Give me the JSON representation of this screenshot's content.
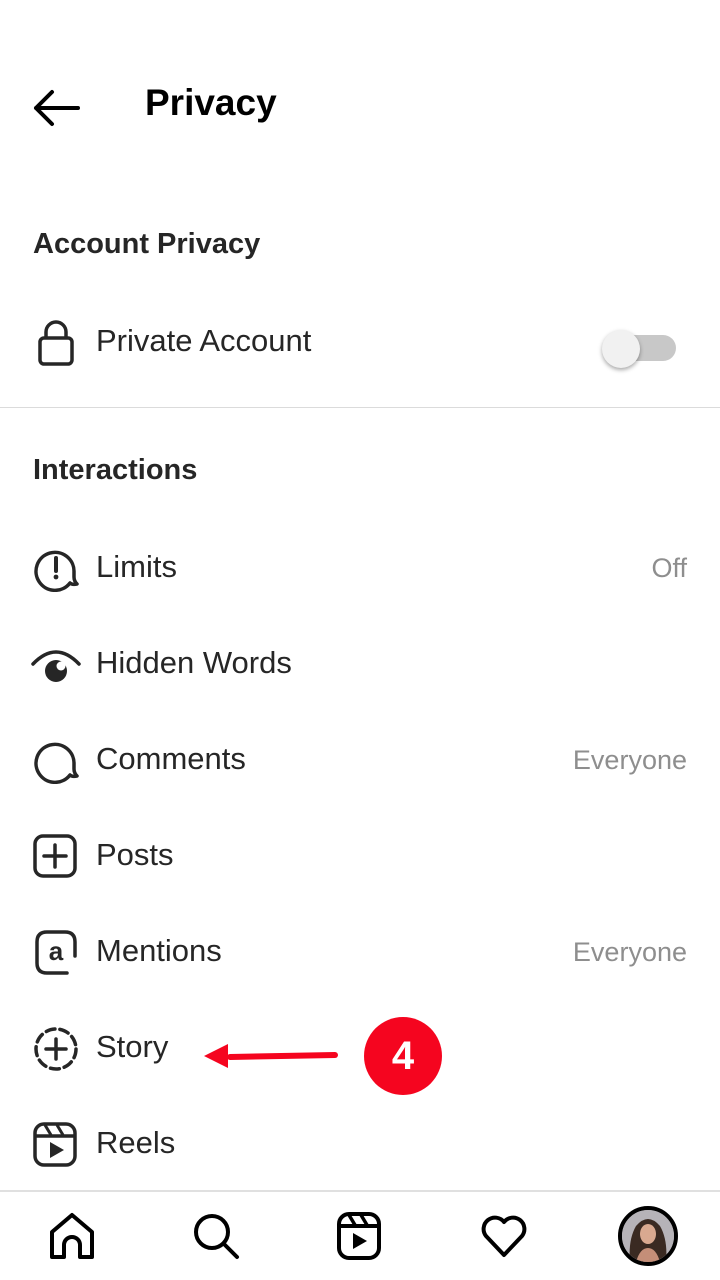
{
  "header": {
    "title": "Privacy",
    "back_icon": "arrow-left-icon"
  },
  "sections": {
    "account_privacy": {
      "title": "Account Privacy",
      "private_account": {
        "label": "Private Account",
        "icon": "lock-icon",
        "toggle_on": false
      }
    },
    "interactions": {
      "title": "Interactions",
      "items": [
        {
          "label": "Limits",
          "value": "Off",
          "icon": "alert-bubble-icon"
        },
        {
          "label": "Hidden Words",
          "value": "",
          "icon": "eye-icon"
        },
        {
          "label": "Comments",
          "value": "Everyone",
          "icon": "comment-icon"
        },
        {
          "label": "Posts",
          "value": "",
          "icon": "plus-square-icon"
        },
        {
          "label": "Mentions",
          "value": "Everyone",
          "icon": "at-icon"
        },
        {
          "label": "Story",
          "value": "",
          "icon": "story-add-icon"
        },
        {
          "label": "Reels",
          "value": "",
          "icon": "reels-icon"
        }
      ]
    }
  },
  "annotation": {
    "step_number": "4",
    "color": "#f5051f",
    "points_to": "Story"
  },
  "bottom_nav": {
    "items": [
      {
        "name": "home",
        "icon": "home-icon"
      },
      {
        "name": "search",
        "icon": "search-icon"
      },
      {
        "name": "reels",
        "icon": "reels-icon"
      },
      {
        "name": "activity",
        "icon": "heart-icon"
      },
      {
        "name": "profile",
        "icon": "avatar"
      }
    ]
  }
}
